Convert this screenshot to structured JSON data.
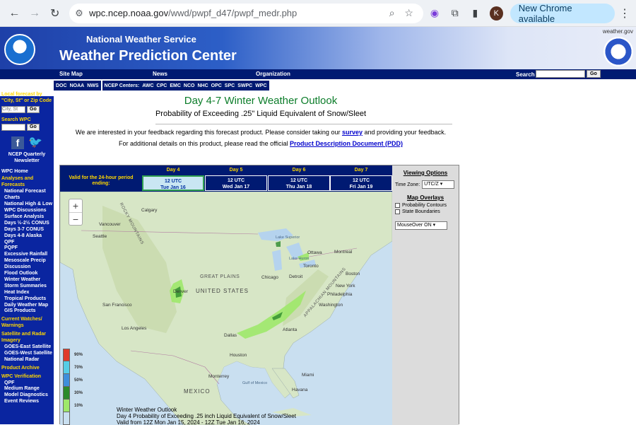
{
  "browser": {
    "url_host": "wpc.ncep.noaa.gov",
    "url_path": "/wwd/pwpf_d47/pwpf_medr.php",
    "avatar_letter": "K",
    "update_label": "New Chrome available"
  },
  "banner": {
    "agency": "National Weather Service",
    "center": "Weather Prediction Center",
    "site": "weather.gov"
  },
  "topmenu": {
    "items": [
      "Site Map",
      "News",
      "Organization"
    ],
    "search_label": "Search",
    "go": "Go"
  },
  "nav2": {
    "group1": [
      "DOC",
      "NOAA",
      "NWS"
    ],
    "group2_label": "NCEP Centers:",
    "group2": [
      "AWC",
      "CPC",
      "EMC",
      "NCO",
      "NHC",
      "OPC",
      "SPC",
      "SWPC",
      "WPC"
    ]
  },
  "sidebar": {
    "local_forecast": "Local forecast by \"City, St\" or Zip Code",
    "city_placeholder": "City, St",
    "go": "Go",
    "search_wpc": "Search WPC",
    "newsletter": "NCEP Quarterly Newsletter",
    "wpc_home": "WPC Home",
    "analyses_header": "Analyses and Forecasts",
    "analyses_items": [
      "National Forecast Charts",
      "National High & Low",
      "WPC Discussions",
      "Surface Analysis",
      "Days ½-2½ CONUS",
      "Days 3-7 CONUS",
      "Days 4-8 Alaska",
      "QPF",
      "PQPF",
      "Excessive Rainfall",
      "Mesoscale Precip Discussion",
      "Flood Outlook",
      "Winter Weather",
      "Storm Summaries",
      "Heat Index",
      "Tropical Products",
      "Daily Weather Map",
      "GIS Products"
    ],
    "watches_header": "Current Watches/ Warnings",
    "sat_header": "Satellite and Radar Imagery",
    "sat_items": [
      "GOES-East Satellite",
      "GOES-West Satellite",
      "National Radar"
    ],
    "archive": "Product Archive",
    "verif_header": "WPC Verification",
    "verif_items": [
      "QPF",
      "Medium Range",
      "Model Diagnostics",
      "Event Reviews"
    ]
  },
  "main": {
    "title": "Day 4-7 Winter Weather Outlook",
    "subtitle": "Probability of Exceeding .25\" Liquid Equivalent of Snow/Sleet",
    "feedback_pre": "We are interested in your feedback regarding this forecast product. Please consider taking our",
    "feedback_link": "survey",
    "feedback_post": "and providing your feedback.",
    "details_pre": "For additional details on this product, please read the official",
    "details_link": "Product Description Document (PDD)"
  },
  "panel": {
    "valid_label": "Valid for the 24-hour period ending:",
    "days": [
      {
        "label": "Day 4",
        "time": "12 UTC",
        "date": "Tue Jan 16",
        "selected": true
      },
      {
        "label": "Day 5",
        "time": "12 UTC",
        "date": "Wed Jan 17",
        "selected": false
      },
      {
        "label": "Day 6",
        "time": "12 UTC",
        "date": "Thu Jan 18",
        "selected": false
      },
      {
        "label": "Day 7",
        "time": "12 UTC",
        "date": "Fri Jan 19",
        "selected": false
      }
    ],
    "zoom_in": "+",
    "zoom_out": "−",
    "legend": [
      {
        "label": "90%",
        "color": "#e03a2a"
      },
      {
        "label": "70%",
        "color": "#55cde6"
      },
      {
        "label": "50%",
        "color": "#3e8edb"
      },
      {
        "label": "30%",
        "color": "#2c8a2c"
      },
      {
        "label": "10%",
        "color": "#9ee86a"
      },
      {
        "label": "",
        "color": "#c9dff0"
      }
    ],
    "caption": [
      "Winter Weather Outlook",
      "Day 4 Probability of Exceeding .25 inch Liquid Equivalent of Snow/Sleet",
      "Valid from 12Z Mon Jan 15, 2024 - 12Z Tue Jan 16, 2024"
    ],
    "map_labels": {
      "cities": [
        "Calgary",
        "Vancouver",
        "Seattle",
        "Denver",
        "San Francisco",
        "Los Angeles",
        "Dallas",
        "Houston",
        "Monterrey",
        "Chicago",
        "Detroit",
        "Toronto",
        "Ottawa",
        "Montreal",
        "Boston",
        "New York",
        "Philadelphia",
        "Washington",
        "Atlanta",
        "Miami",
        "Havana"
      ],
      "regions": [
        "GREAT PLAINS",
        "ROCKY MOUNTAINS",
        "APPALACHIAN MOUNTAINS",
        "Lake Superior",
        "Lake Huron",
        "Gulf of Mexico"
      ],
      "countries": [
        "UNITED STATES",
        "MEXICO"
      ]
    },
    "options": {
      "title": "Viewing Options",
      "tz_label": "Time Zone:",
      "tz_value": "UTC/Z",
      "overlays_title": "Map Overlays",
      "overlay1": "Probability Contours",
      "overlay2": "State Boundaries",
      "mouseover_value": "MouseOver ON"
    }
  }
}
